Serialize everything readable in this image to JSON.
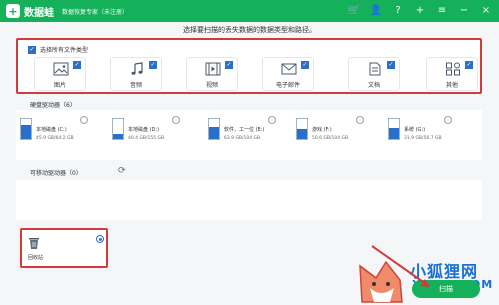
{
  "titlebar": {
    "app_name": "数据蛙",
    "app_sub": "数据恢复专家（未注册）",
    "logo_glyph": "+",
    "icons": [
      "cart-icon",
      "user-icon",
      "question-icon",
      "plus-icon",
      "menu-icon",
      "minimize-icon",
      "close-icon"
    ],
    "icon_glyphs": [
      "🛒",
      "👤",
      "?",
      "+",
      "≡",
      "−",
      "×"
    ],
    "accent": "#14b05a"
  },
  "heading": "选择要扫描的丢失数据的数据类型和路径。",
  "file_types": {
    "select_all_label": "选择所有文件类型",
    "select_all_checked": true,
    "items": [
      {
        "label": "图片",
        "icon": "image-icon",
        "checked": true
      },
      {
        "label": "音频",
        "icon": "music-icon",
        "checked": true
      },
      {
        "label": "视频",
        "icon": "video-icon",
        "checked": true
      },
      {
        "label": "电子邮件",
        "icon": "mail-icon",
        "checked": true
      },
      {
        "label": "文档",
        "icon": "document-icon",
        "checked": true
      },
      {
        "label": "其他",
        "icon": "other-icon",
        "checked": true
      }
    ]
  },
  "drives": {
    "section_label": "硬盘驱动器（6）",
    "items": [
      {
        "name": "本地磁盘 (C:)",
        "size": "45.9 GB/64.2 GB",
        "used_fraction": 0.71,
        "selected": false
      },
      {
        "name": "本地磁盘 (D:)",
        "size": "40.4 GB/155 GB",
        "used_fraction": 0.26,
        "selected": false
      },
      {
        "name": "软件，工一位 (E:)",
        "size": "63.9 GB/104 GB",
        "used_fraction": 0.61,
        "selected": false
      },
      {
        "name": "游戏 (F:)",
        "size": "50.6 GB/104 GB",
        "used_fraction": 0.49,
        "selected": false
      },
      {
        "name": "系统 (G:)",
        "size": "31.9 GB/56.7 GB",
        "used_fraction": 0.56,
        "selected": false
      }
    ]
  },
  "removable": {
    "section_label": "可移动驱动器（0）",
    "refresh_icon": "refresh-icon"
  },
  "recycle_bin": {
    "label": "回收站",
    "selected": true
  },
  "scan_button": {
    "label": "扫描"
  },
  "watermark": {
    "text": "小狐狸网",
    "sub": "XHLLS.COM"
  }
}
